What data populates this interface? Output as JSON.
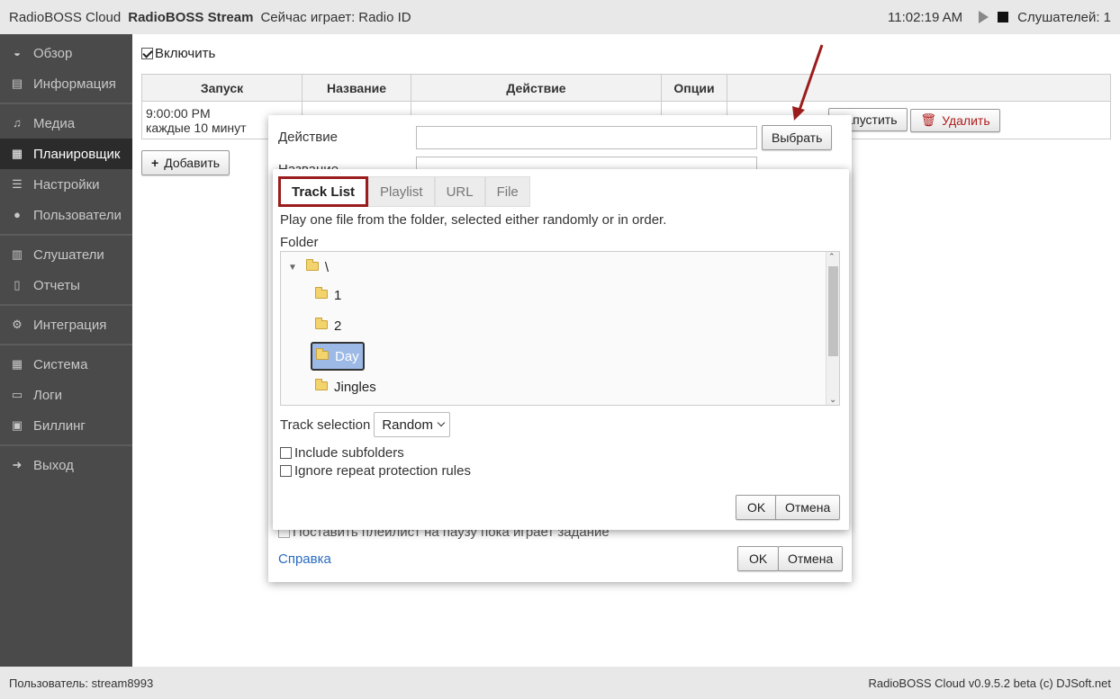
{
  "topbar": {
    "app_name": "RadioBOSS Cloud",
    "stream_name": "RadioBOSS Stream",
    "now_playing_label": "Сейчас играет:",
    "now_playing_value": "Radio ID",
    "time": "11:02:19 AM",
    "listeners": "Слушателей: 1"
  },
  "sidebar": {
    "items": [
      {
        "label": "Обзор",
        "icon": "dashboard-icon"
      },
      {
        "label": "Информация",
        "icon": "book-icon"
      },
      {
        "label": "Медиа",
        "icon": "music-icon"
      },
      {
        "label": "Планировщик",
        "icon": "calendar-icon",
        "active": true
      },
      {
        "label": "Настройки",
        "icon": "sliders-icon"
      },
      {
        "label": "Пользователи",
        "icon": "user-icon"
      },
      {
        "label": "Слушатели",
        "icon": "bar-chart-icon"
      },
      {
        "label": "Отчеты",
        "icon": "document-icon"
      },
      {
        "label": "Интеграция",
        "icon": "gears-icon"
      },
      {
        "label": "Система",
        "icon": "grid-icon"
      },
      {
        "label": "Логи",
        "icon": "folder-icon"
      },
      {
        "label": "Биллинг",
        "icon": "money-icon"
      },
      {
        "label": "Выход",
        "icon": "sign-out-icon"
      }
    ]
  },
  "main": {
    "enable_label": "Включить",
    "table": {
      "headers": [
        "Запуск",
        "Название",
        "Действие",
        "Опции",
        ""
      ],
      "row": {
        "start_line1": "9:00:00 PM",
        "start_line2": "каждые 10 минут",
        "run_label": "Запустить",
        "delete_label": "Удалить"
      }
    },
    "add_label": "Добавить"
  },
  "dialog_outer": {
    "action_label": "Действие",
    "name_label": "Название",
    "choose_label": "Выбрать",
    "pause_label": "Поставить плейлист на паузу пока играет задание",
    "help_label": "Справка",
    "ok_label": "OK",
    "cancel_label": "Отмена"
  },
  "dialog_inner": {
    "tabs": [
      "Track List",
      "Playlist",
      "URL",
      "File"
    ],
    "description": "Play one file from the folder, selected either randomly or in order.",
    "folder_label": "Folder",
    "tree": {
      "root": "\\",
      "children": [
        "1",
        "2",
        "Day",
        "Jingles"
      ],
      "selected": "Day"
    },
    "track_selection_label": "Track selection",
    "track_selection_value": "Random",
    "include_subfolders": "Include subfolders",
    "ignore_repeat": "Ignore repeat protection rules",
    "ok_label": "OK",
    "cancel_label": "Отмена"
  },
  "footer": {
    "user": "Пользователь: stream8993",
    "version": "RadioBOSS Cloud v0.9.5.2 beta (c) DJSoft.net"
  },
  "colors": {
    "sidebar_bg": "#4a4a4a",
    "sidebar_active": "#2b2b2b",
    "highlight_red": "#9b1c1c",
    "selected_node": "#9db9e6"
  }
}
